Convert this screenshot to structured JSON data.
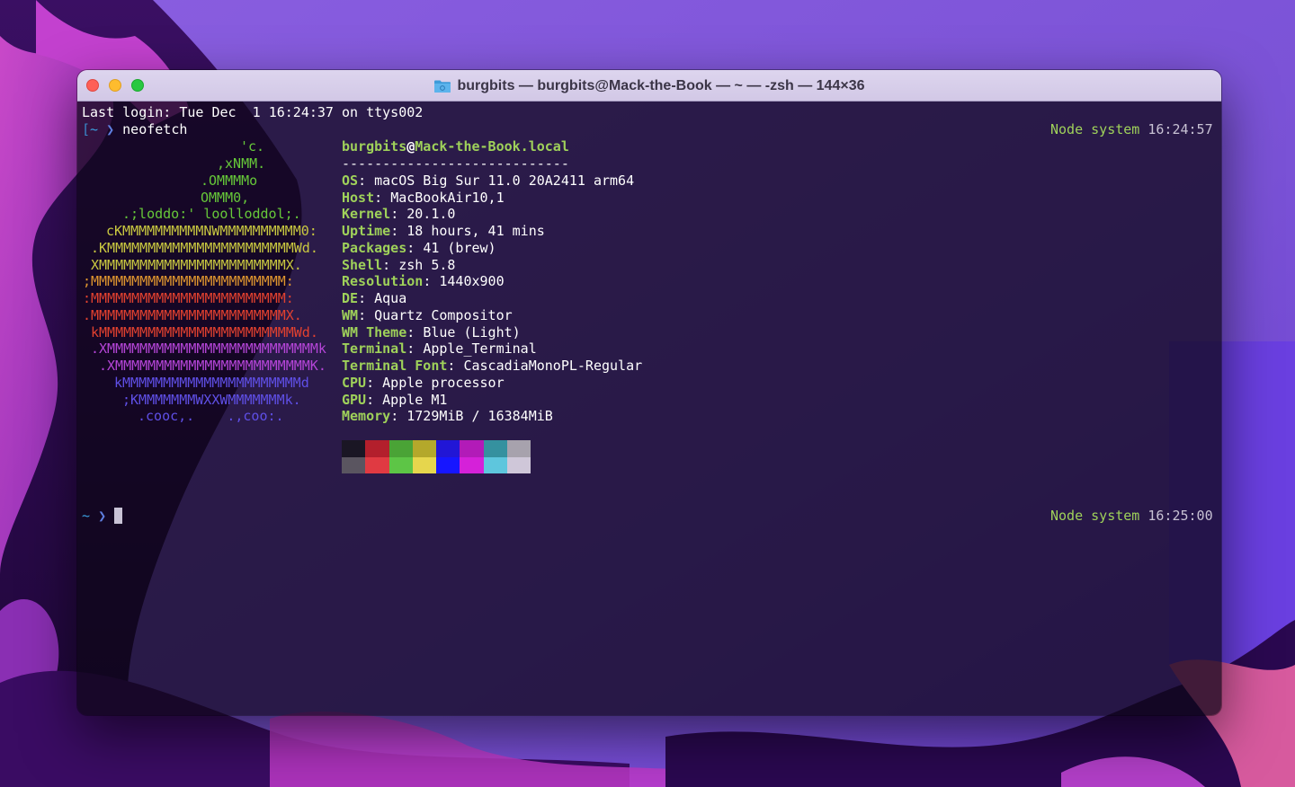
{
  "window": {
    "title": "burgbits — burgbits@Mack-the-Book — ~ — -zsh — 144×36",
    "icon": "folder-icon"
  },
  "terminal": {
    "last_login": "Last login: Tue Dec  1 16:24:37 on ttys002",
    "prompt1": {
      "bracket": "[",
      "path": "~",
      "arrow": "❯",
      "command": "neofetch"
    },
    "rprompt1": {
      "node": "Node",
      "system": "system",
      "time": "16:24:57",
      "tail": "]"
    },
    "logo_lines": [
      "'c.",
      ",xNMM.",
      ".OMMMMo",
      "OMMM0,",
      ".;loddo:' loolloddol;.",
      "cKMMMMMMMMMMNWMMMMMMMMMM0:",
      ".KMMMMMMMMMMMMMMMMMMMMMMMWd.",
      "XMMMMMMMMMMMMMMMMMMMMMMMX.",
      ";MMMMMMMMMMMMMMMMMMMMMMMM:",
      ":MMMMMMMMMMMMMMMMMMMMMMMM:",
      ".MMMMMMMMMMMMMMMMMMMMMMMMX.",
      "kMMMMMMMMMMMMMMMMMMMMMMMMWd.",
      ".XMMMMMMMMMMMMMMMMMMMMMMMMMMk",
      ".XMMMMMMMMMMMMMMMMMMMMMMMMK.",
      "kMMMMMMMMMMMMMMMMMMMMMMd",
      ";KMMMMMMMWXXWMMMMMMMk.",
      ".cooc,.    .,coo:."
    ],
    "user": "burgbits",
    "at": "@",
    "host": "Mack-the-Book.local",
    "separator": "----------------------------",
    "info": [
      {
        "key": "OS",
        "value": "macOS Big Sur 11.0 20A2411 arm64"
      },
      {
        "key": "Host",
        "value": "MacBookAir10,1"
      },
      {
        "key": "Kernel",
        "value": "20.1.0"
      },
      {
        "key": "Uptime",
        "value": "18 hours, 41 mins"
      },
      {
        "key": "Packages",
        "value": "41 (brew)"
      },
      {
        "key": "Shell",
        "value": "zsh 5.8"
      },
      {
        "key": "Resolution",
        "value": "1440x900"
      },
      {
        "key": "DE",
        "value": "Aqua"
      },
      {
        "key": "WM",
        "value": "Quartz Compositor"
      },
      {
        "key": "WM Theme",
        "value": "Blue (Light)"
      },
      {
        "key": "Terminal",
        "value": "Apple_Terminal"
      },
      {
        "key": "Terminal Font",
        "value": "CascadiaMonoPL-Regular"
      },
      {
        "key": "CPU",
        "value": "Apple processor"
      },
      {
        "key": "GPU",
        "value": "Apple M1"
      },
      {
        "key": "Memory",
        "value": "1729MiB / 16384MiB"
      }
    ],
    "colors_top": [
      "#1a1624",
      "#b31f2c",
      "#4aa336",
      "#b4a82b",
      "#2116d6",
      "#b21bb8",
      "#35919f",
      "#a7a2ad"
    ],
    "colors_bottom": [
      "#5a5560",
      "#e03a42",
      "#5dc546",
      "#e6d64d",
      "#1616ff",
      "#d521d9",
      "#5ec6dd",
      "#cfc7d9"
    ],
    "prompt2": {
      "path": "~",
      "arrow": "❯"
    },
    "rprompt2": {
      "node": "Node",
      "system": "system",
      "time": "16:25:00"
    }
  },
  "colors": {
    "accent_green": "#9fd15a",
    "titlebar": "#d6cdea"
  }
}
